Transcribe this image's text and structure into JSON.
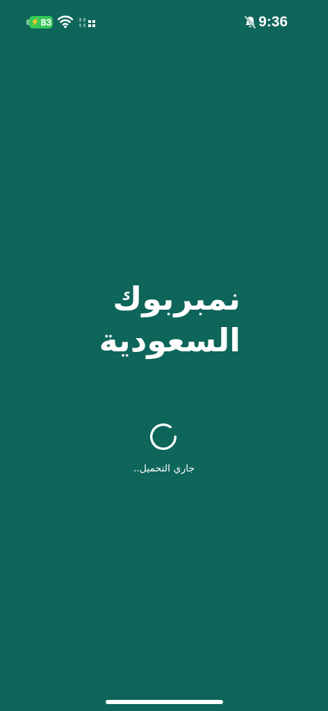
{
  "status_bar": {
    "time": "9:36",
    "battery_level": "83",
    "battery_charging": true,
    "wifi_icon": "wifi-icon",
    "signal_icon": "cellular-signal-icon",
    "silent_icon": "bell-slash-icon",
    "battery_color": "#34c759"
  },
  "splash": {
    "logo_line_1": "نمبربوك",
    "logo_line_2": "السعودية",
    "loading_text": "جاري التحميل..",
    "spinner_icon": "loading-spinner-icon",
    "background_color": "#0e655a"
  }
}
